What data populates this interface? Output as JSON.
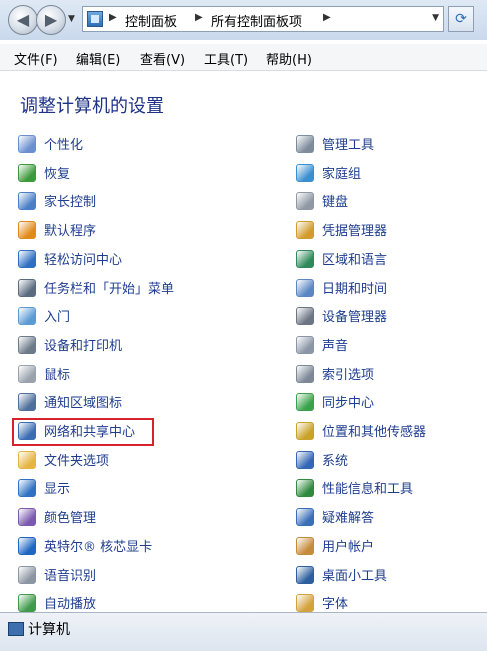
{
  "address": {
    "back_glyph": "◀",
    "forward_glyph": "▶",
    "crumbs": [
      "控制面板",
      "所有控制面板项"
    ]
  },
  "menu": {
    "file": "文件(F)",
    "edit": "编辑(E)",
    "view": "查看(V)",
    "tools": "工具(T)",
    "help": "帮助(H)"
  },
  "heading": "调整计算机的设置",
  "left_items": [
    {
      "label": "个性化",
      "icon": "personalization-icon",
      "color": "#6b8fd0"
    },
    {
      "label": "恢复",
      "icon": "recovery-icon",
      "color": "#3c9a3c"
    },
    {
      "label": "家长控制",
      "icon": "parental-controls-icon",
      "color": "#4a7fc6"
    },
    {
      "label": "默认程序",
      "icon": "default-programs-icon",
      "color": "#e08a1a"
    },
    {
      "label": "轻松访问中心",
      "icon": "ease-of-access-icon",
      "color": "#2f6fc2"
    },
    {
      "label": "任务栏和「开始」菜单",
      "icon": "taskbar-icon",
      "color": "#5a6b80"
    },
    {
      "label": "入门",
      "icon": "getting-started-icon",
      "color": "#5b9bd5"
    },
    {
      "label": "设备和打印机",
      "icon": "devices-printers-icon",
      "color": "#6c7a89"
    },
    {
      "label": "鼠标",
      "icon": "mouse-icon",
      "color": "#9aa3ad"
    },
    {
      "label": "通知区域图标",
      "icon": "notification-area-icon",
      "color": "#4d6f9a"
    },
    {
      "label": "网络和共享中心",
      "icon": "network-sharing-icon",
      "color": "#3b6db3"
    },
    {
      "label": "文件夹选项",
      "icon": "folder-options-icon",
      "color": "#e5b443"
    },
    {
      "label": "显示",
      "icon": "display-icon",
      "color": "#2f72c4"
    },
    {
      "label": "颜色管理",
      "icon": "color-management-icon",
      "color": "#7b5ab0"
    },
    {
      "label": "英特尔® 核芯显卡",
      "icon": "intel-graphics-icon",
      "color": "#1f67c2"
    },
    {
      "label": "语音识别",
      "icon": "speech-recognition-icon",
      "color": "#8c96a3"
    },
    {
      "label": "自动播放",
      "icon": "autoplay-icon",
      "color": "#3f9a4a"
    }
  ],
  "right_items": [
    {
      "label": "管理工具",
      "icon": "admin-tools-icon",
      "color": "#7d8b9b"
    },
    {
      "label": "家庭组",
      "icon": "homegroup-icon",
      "color": "#3a8fd0"
    },
    {
      "label": "键盘",
      "icon": "keyboard-icon",
      "color": "#8f98a3"
    },
    {
      "label": "凭据管理器",
      "icon": "credential-manager-icon",
      "color": "#d29b2b"
    },
    {
      "label": "区域和语言",
      "icon": "region-language-icon",
      "color": "#2e8a5a"
    },
    {
      "label": "日期和时间",
      "icon": "date-time-icon",
      "color": "#5b86c4"
    },
    {
      "label": "设备管理器",
      "icon": "device-manager-icon",
      "color": "#6b7583"
    },
    {
      "label": "声音",
      "icon": "sound-icon",
      "color": "#8a96a5"
    },
    {
      "label": "索引选项",
      "icon": "indexing-options-icon",
      "color": "#7c8896"
    },
    {
      "label": "同步中心",
      "icon": "sync-center-icon",
      "color": "#3aa24a"
    },
    {
      "label": "位置和其他传感器",
      "icon": "location-sensors-icon",
      "color": "#c9a227"
    },
    {
      "label": "系统",
      "icon": "system-icon",
      "color": "#3366b5"
    },
    {
      "label": "性能信息和工具",
      "icon": "performance-icon",
      "color": "#2f8a3f"
    },
    {
      "label": "疑难解答",
      "icon": "troubleshooting-icon",
      "color": "#3a6fb8"
    },
    {
      "label": "用户帐户",
      "icon": "user-accounts-icon",
      "color": "#c58a3a"
    },
    {
      "label": "桌面小工具",
      "icon": "gadgets-icon",
      "color": "#2d5f9e"
    },
    {
      "label": "字体",
      "icon": "fonts-icon",
      "color": "#d3a23a"
    }
  ],
  "status": {
    "text": "计算机"
  }
}
